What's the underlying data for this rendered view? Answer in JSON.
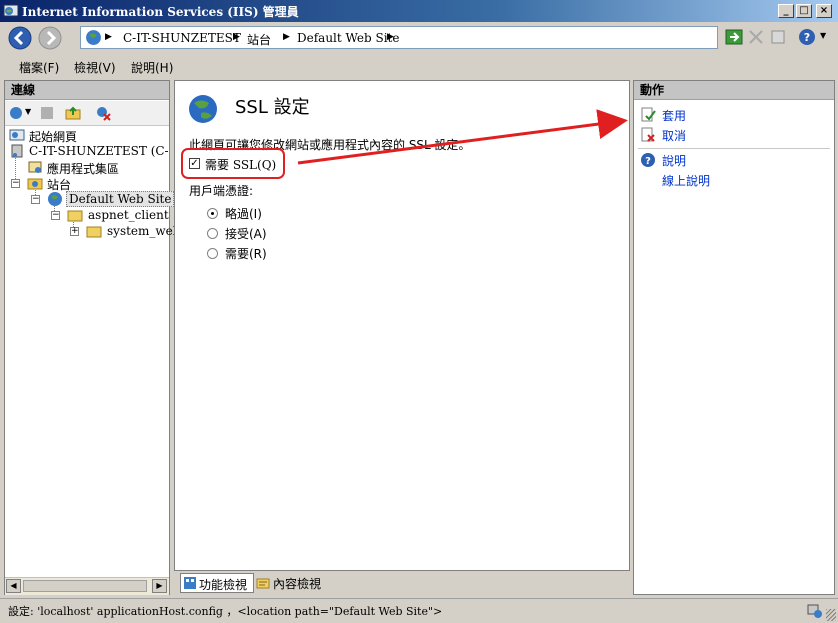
{
  "window": {
    "title": "Internet Information Services (IIS) 管理員"
  },
  "address": {
    "segments": [
      "C-IT-SHUNZETEST",
      "站台",
      "Default Web Site"
    ]
  },
  "menu": {
    "items": [
      "檔案(F)",
      "檢視(V)",
      "說明(H)"
    ]
  },
  "connections": {
    "title": "連線",
    "tree": [
      {
        "label": "起始網頁",
        "level": 0
      },
      {
        "label": "C-IT-SHUNZETEST (C-I…",
        "level": 0
      },
      {
        "label": "應用程式集區",
        "level": 1
      },
      {
        "label": "站台",
        "level": 1
      },
      {
        "label": "Default Web Site",
        "level": 2
      },
      {
        "label": "aspnet_client",
        "level": 3
      },
      {
        "label": "system_web",
        "level": 4
      }
    ]
  },
  "center": {
    "title": "SSL 設定",
    "description": "此網頁可讓您修改網站或應用程式內容的 SSL 設定。",
    "require_ssl": {
      "label": "需要 SSL(Q)",
      "checked": true
    },
    "client_cert_label": "用戶端憑證:",
    "client_cert_options": [
      {
        "label": "略過(I)",
        "selected": true
      },
      {
        "label": "接受(A)",
        "selected": false
      },
      {
        "label": "需要(R)",
        "selected": false
      }
    ],
    "views": {
      "features": "功能檢視",
      "content": "內容檢視"
    }
  },
  "actions": {
    "title": "動作",
    "items": [
      "套用",
      "取消",
      "說明",
      "線上說明"
    ]
  },
  "status": {
    "text": "設定: 'localhost' applicationHost.config  ，<location path=\"Default Web Site\">"
  },
  "colors": {
    "titlebar": "#0a246a",
    "link": "#0033cc",
    "callout": "#e02020",
    "panel_header": "#c4c4c4"
  }
}
